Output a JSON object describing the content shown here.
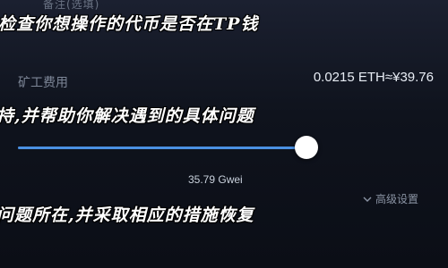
{
  "top_note": "备注(选填)",
  "banners": {
    "line1": "检查你想操作的代币是否在TP钱",
    "line2": "持,并帮助你解决遇到的具体问题",
    "line3": "问题所在,并采取相应的措施恢复"
  },
  "fee": {
    "label": "矿工费用",
    "amount": "0.0215 ETH≈¥39.76"
  },
  "gas_slider": {
    "level": 0.97,
    "value_text": "35.79 Gwei"
  },
  "advanced": {
    "label": "高级设置",
    "icon": "chevron-down-icon"
  },
  "colors": {
    "accent": "#4a90e2",
    "background": "#0d1019"
  }
}
